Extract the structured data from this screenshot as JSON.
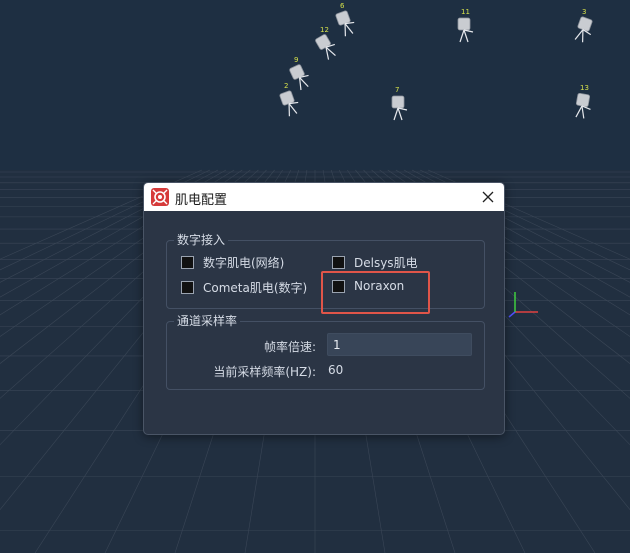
{
  "scene": {
    "camera_labels": [
      "6",
      "12",
      "9",
      "2",
      "11",
      "7",
      "3",
      "13"
    ],
    "colors": {
      "sky": "#1e2f42",
      "floor_line": "#3a4656",
      "camera_label": "#d4e04a",
      "axis_x": "#e04040",
      "axis_y": "#40d040",
      "axis_z": "#5050ff"
    }
  },
  "dialog": {
    "title": "肌电配置",
    "icon": "app-logo-icon",
    "close_icon": "close-icon",
    "digital_group": {
      "title": "数字接入",
      "options": [
        {
          "label": "数字肌电(网络)",
          "checked": false
        },
        {
          "label": "Delsys肌电",
          "checked": false
        },
        {
          "label": "Cometa肌电(数字)",
          "checked": false
        },
        {
          "label": "Noraxon",
          "checked": false,
          "highlighted": true
        }
      ]
    },
    "channel_group": {
      "title": "通道采样率",
      "frame_rate_label": "帧率倍速:",
      "frame_rate_value": "1",
      "sample_rate_label": "当前采样频率(HZ):",
      "sample_rate_value": "60"
    },
    "colors": {
      "background": "#2b3545",
      "titlebar": "#ffffff",
      "highlight": "#e05549"
    }
  }
}
